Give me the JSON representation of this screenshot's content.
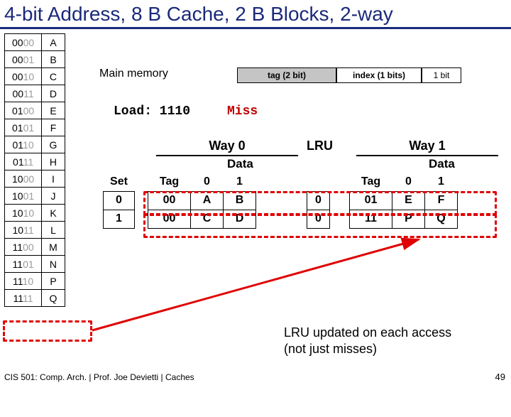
{
  "title": "4-bit Address, 8 B Cache, 2 B Blocks, 2-way",
  "mem_label": "Main memory",
  "memory": {
    "rows": [
      {
        "addr_hi": "00",
        "addr_lo": "00",
        "val": "A"
      },
      {
        "addr_hi": "00",
        "addr_lo": "01",
        "val": "B"
      },
      {
        "addr_hi": "00",
        "addr_lo": "10",
        "val": "C"
      },
      {
        "addr_hi": "00",
        "addr_lo": "11",
        "val": "D"
      },
      {
        "addr_hi": "01",
        "addr_lo": "00",
        "val": "E"
      },
      {
        "addr_hi": "01",
        "addr_lo": "01",
        "val": "F"
      },
      {
        "addr_hi": "01",
        "addr_lo": "10",
        "val": "G"
      },
      {
        "addr_hi": "01",
        "addr_lo": "11",
        "val": "H"
      },
      {
        "addr_hi": "10",
        "addr_lo": "00",
        "val": "I"
      },
      {
        "addr_hi": "10",
        "addr_lo": "01",
        "val": "J"
      },
      {
        "addr_hi": "10",
        "addr_lo": "10",
        "val": "K"
      },
      {
        "addr_hi": "10",
        "addr_lo": "11",
        "val": "L"
      },
      {
        "addr_hi": "11",
        "addr_lo": "00",
        "val": "M"
      },
      {
        "addr_hi": "11",
        "addr_lo": "01",
        "val": "N"
      },
      {
        "addr_hi": "11",
        "addr_lo": "10",
        "val": "P"
      },
      {
        "addr_hi": "11",
        "addr_lo": "11",
        "val": "Q"
      }
    ]
  },
  "addr_layout": {
    "tag": "tag (2 bit)",
    "index": "index (1 bits)",
    "size": "1 bit"
  },
  "load": {
    "label": "Load: 1110",
    "result": "Miss"
  },
  "way0_label": "Way 0",
  "way1_label": "Way 1",
  "lru_label": "LRU",
  "data_label": "Data",
  "headers": {
    "set": "Set",
    "tag": "Tag",
    "d0": "0",
    "d1": "1"
  },
  "cache": {
    "rows": [
      {
        "set": "0",
        "tag0": "00",
        "d00": "A",
        "d01": "B",
        "lru": "0",
        "tag1": "01",
        "d10": "E",
        "d11": "F"
      },
      {
        "set": "1",
        "tag0": "00",
        "d00": "C",
        "d01": "D",
        "lru": "0",
        "tag1": "11",
        "d10": "P",
        "d11": "Q"
      }
    ]
  },
  "note_l1": "LRU updated on each access",
  "note_l2": "(not just misses)",
  "footer": "CIS 501: Comp. Arch.  |  Prof. Joe Devietti  |  Caches",
  "page": "49",
  "chart_data": {
    "type": "table",
    "title": "2-way set-associative cache, 4-bit address, 8B capacity, 2B blocks",
    "address_bits": {
      "tag": 2,
      "index": 1,
      "offset": 1
    },
    "access": {
      "address": "1110",
      "result": "Miss"
    },
    "sets": [
      {
        "set": 0,
        "lru": 0,
        "way0": {
          "tag": "00",
          "data": [
            "A",
            "B"
          ]
        },
        "way1": {
          "tag": "01",
          "data": [
            "E",
            "F"
          ]
        }
      },
      {
        "set": 1,
        "lru": 0,
        "way0": {
          "tag": "00",
          "data": [
            "C",
            "D"
          ]
        },
        "way1": {
          "tag": "11",
          "data": [
            "P",
            "Q"
          ]
        }
      }
    ],
    "main_memory": [
      [
        "0000",
        "A"
      ],
      [
        "0001",
        "B"
      ],
      [
        "0010",
        "C"
      ],
      [
        "0011",
        "D"
      ],
      [
        "0100",
        "E"
      ],
      [
        "0101",
        "F"
      ],
      [
        "0110",
        "G"
      ],
      [
        "0111",
        "H"
      ],
      [
        "1000",
        "I"
      ],
      [
        "1001",
        "J"
      ],
      [
        "1010",
        "K"
      ],
      [
        "1011",
        "L"
      ],
      [
        "1100",
        "M"
      ],
      [
        "1101",
        "N"
      ],
      [
        "1110",
        "P"
      ],
      [
        "1111",
        "Q"
      ]
    ]
  }
}
